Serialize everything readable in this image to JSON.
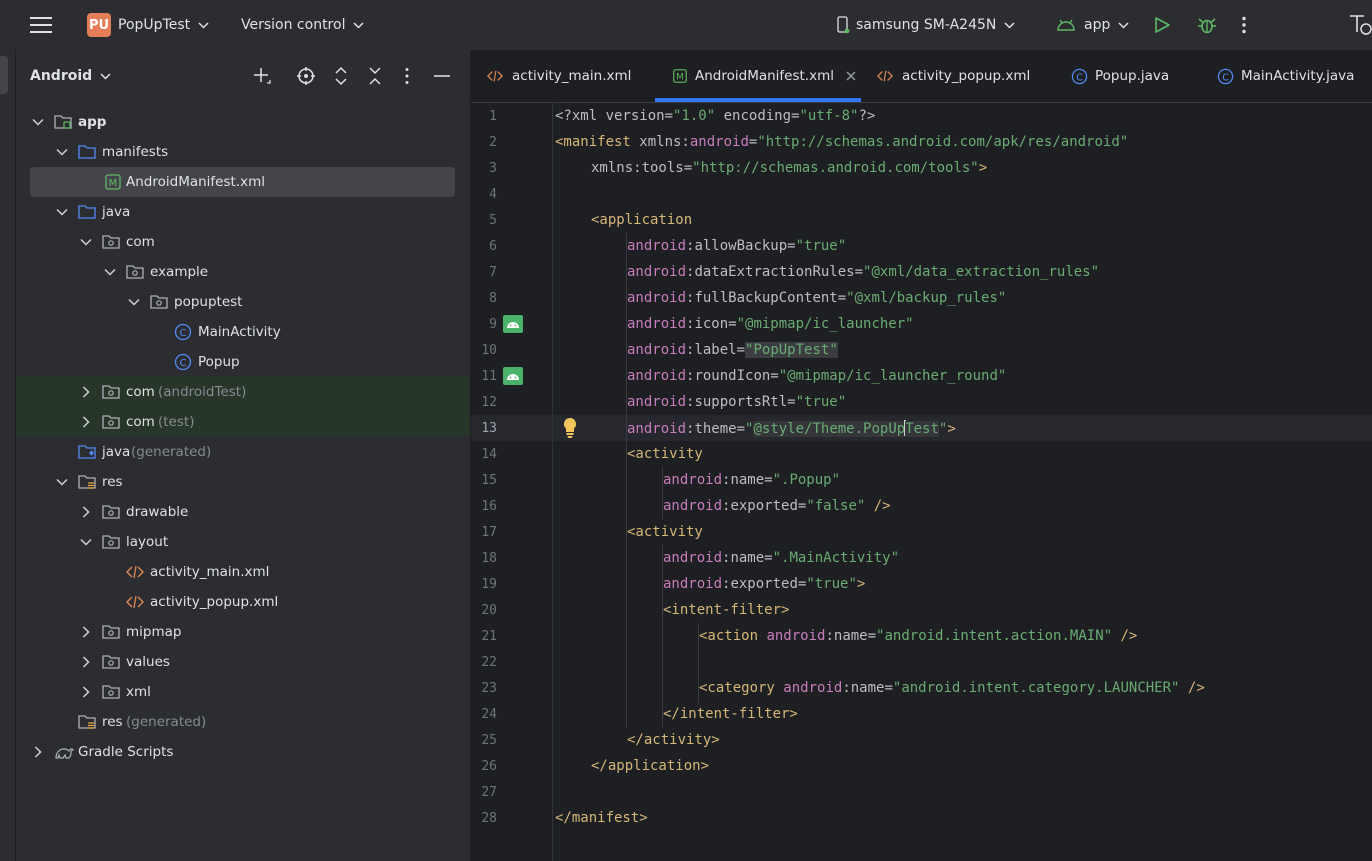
{
  "topbar": {
    "project_badge": "PU",
    "project_name": "PopUpTest",
    "vcs_label": "Version control",
    "device_label": "samsung SM-A245N",
    "run_config": "app"
  },
  "project_panel": {
    "view_label": "Android",
    "tree": [
      {
        "label": "app",
        "bold": true
      },
      {
        "label": "manifests"
      },
      {
        "label": "AndroidManifest.xml"
      },
      {
        "label": "java"
      },
      {
        "label": "com"
      },
      {
        "label": "example"
      },
      {
        "label": "popuptest"
      },
      {
        "label": "MainActivity"
      },
      {
        "label": "Popup"
      },
      {
        "label": "com",
        "suffix": "(androidTest)"
      },
      {
        "label": "com",
        "suffix": "(test)"
      },
      {
        "label": "java",
        "suffix": "(generated)"
      },
      {
        "label": "res"
      },
      {
        "label": "drawable"
      },
      {
        "label": "layout"
      },
      {
        "label": "activity_main.xml"
      },
      {
        "label": "activity_popup.xml"
      },
      {
        "label": "mipmap"
      },
      {
        "label": "values"
      },
      {
        "label": "xml"
      },
      {
        "label": "res",
        "suffix": "(generated)"
      },
      {
        "label": "Gradle Scripts"
      }
    ]
  },
  "editor": {
    "tabs": [
      {
        "label": "activity_main.xml"
      },
      {
        "label": "AndroidManifest.xml",
        "active": true
      },
      {
        "label": "activity_popup.xml"
      },
      {
        "label": "Popup.java"
      },
      {
        "label": "MainActivity.java"
      }
    ],
    "line_numbers": [
      "1",
      "2",
      "3",
      "4",
      "5",
      "6",
      "7",
      "8",
      "9",
      "10",
      "11",
      "12",
      "13",
      "14",
      "15",
      "16",
      "17",
      "18",
      "19",
      "20",
      "21",
      "22",
      "23",
      "24",
      "25",
      "26",
      "27",
      "28"
    ],
    "current_line": 13,
    "code": {
      "l1": {
        "decl": "<?xml version=",
        "v1": "\"1.0\"",
        "mid": " encoding=",
        "v2": "\"utf-8\"",
        "end": "?>"
      },
      "l2": {
        "open": "<manifest",
        "sp": " xmlns:",
        "ns": "android",
        "eq": "=",
        "val": "\"http://schemas.android.com/apk/res/android\""
      },
      "l3": {
        "attr": "xmlns:tools=",
        "val": "\"http://schemas.android.com/tools\"",
        "end": ">"
      },
      "l5": {
        "open": "<application"
      },
      "l6": {
        "ns": "android",
        "attr": ":allowBackup=",
        "val": "\"true\""
      },
      "l7": {
        "ns": "android",
        "attr": ":dataExtractionRules=",
        "val": "\"@xml/data_extraction_rules\""
      },
      "l8": {
        "ns": "android",
        "attr": ":fullBackupContent=",
        "val": "\"@xml/backup_rules\""
      },
      "l9": {
        "ns": "android",
        "attr": ":icon=",
        "val": "\"@mipmap/ic_launcher\""
      },
      "l10": {
        "ns": "android",
        "attr": ":label=",
        "val": "\"PopUpTest\""
      },
      "l11": {
        "ns": "android",
        "attr": ":roundIcon=",
        "val": "\"@mipmap/ic_launcher_round\""
      },
      "l12": {
        "ns": "android",
        "attr": ":supportsRtl=",
        "val": "\"true\""
      },
      "l13": {
        "ns": "android",
        "attr": ":theme=",
        "q": "\"",
        "val_a": "@style/Theme.PopUp",
        "val_b": "Test",
        "q2": "\"",
        "end": ">"
      },
      "l14": {
        "open": "<activity"
      },
      "l15": {
        "ns": "android",
        "attr": ":name=",
        "val": "\".Popup\""
      },
      "l16": {
        "ns": "android",
        "attr": ":exported=",
        "val": "\"false\"",
        "end": " />"
      },
      "l17": {
        "open": "<activity"
      },
      "l18": {
        "ns": "android",
        "attr": ":name=",
        "val": "\".MainActivity\""
      },
      "l19": {
        "ns": "android",
        "attr": ":exported=",
        "val": "\"true\"",
        "end": ">"
      },
      "l20": {
        "open": "<intent-filter>"
      },
      "l21": {
        "open": "<action",
        "sp": " ",
        "ns": "android",
        "attr": ":name=",
        "val": "\"android.intent.action.MAIN\"",
        "end": " />"
      },
      "l23": {
        "open": "<category",
        "sp": " ",
        "ns": "android",
        "attr": ":name=",
        "val": "\"android.intent.category.LAUNCHER\"",
        "end": " />"
      },
      "l24": {
        "close": "</intent-filter>"
      },
      "l25": {
        "close": "</activity>"
      },
      "l26": {
        "close": "</application>"
      },
      "l28": {
        "close": "</manifest>"
      }
    }
  },
  "colors": {
    "accent": "#3574f0",
    "xml_tag": "#d5b778",
    "xml_namespace": "#c77dbb",
    "xml_string": "#6aab73",
    "android_green": "#4bb26a"
  }
}
